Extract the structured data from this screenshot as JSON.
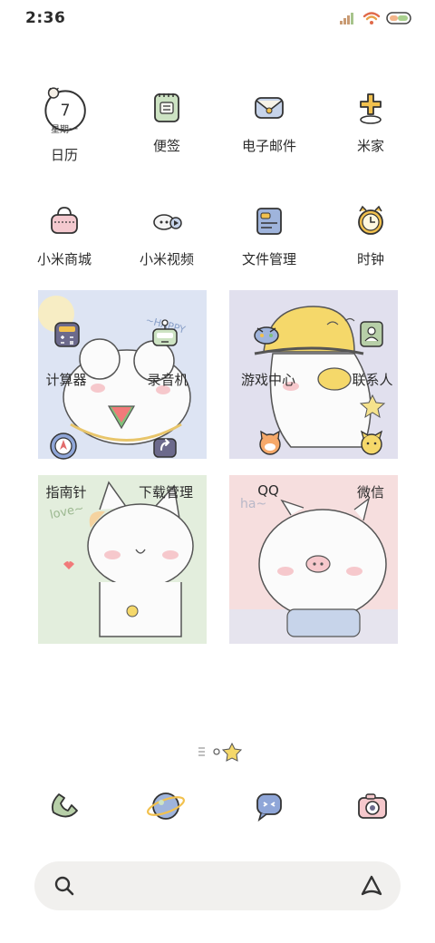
{
  "status_bar": {
    "time": "2:36"
  },
  "calendar": {
    "day": "7",
    "weekday": "星期一"
  },
  "apps_row1": [
    {
      "label": "日历",
      "icon": "calendar-icon"
    },
    {
      "label": "便签",
      "icon": "notes-icon"
    },
    {
      "label": "电子邮件",
      "icon": "mail-icon"
    },
    {
      "label": "米家",
      "icon": "mijia-icon"
    }
  ],
  "apps_row2": [
    {
      "label": "小米商城",
      "icon": "shop-icon"
    },
    {
      "label": "小米视频",
      "icon": "video-icon"
    },
    {
      "label": "文件管理",
      "icon": "files-icon"
    },
    {
      "label": "时钟",
      "icon": "clock-icon"
    }
  ],
  "card_apps": {
    "calculator": "计算器",
    "recorder": "录音机",
    "game_center": "游戏中心",
    "contacts": "联系人",
    "compass": "指南针",
    "downloads": "下载管理",
    "qq": "QQ",
    "wechat": "微信"
  },
  "card_art_text": {
    "happy": "~HAPPY",
    "love": "love~",
    "ha": "ha~"
  },
  "dock": [
    {
      "icon": "phone-icon"
    },
    {
      "icon": "browser-icon"
    },
    {
      "icon": "messages-icon"
    },
    {
      "icon": "camera-icon"
    }
  ],
  "search": {
    "placeholder": ""
  },
  "colors": {
    "card_blue": "#dde4f3",
    "card_purple": "#e1e0ee",
    "card_green": "#e3eedd",
    "card_pink": "#f6dede"
  }
}
